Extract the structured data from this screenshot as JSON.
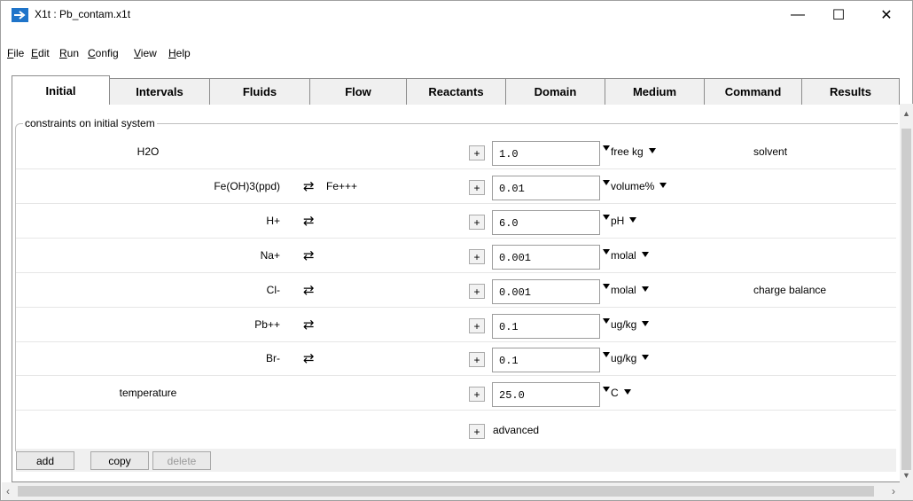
{
  "window": {
    "title": "X1t : Pb_contam.x1t"
  },
  "menu": [
    {
      "pre": "",
      "u": "F",
      "post": "ile"
    },
    {
      "pre": "",
      "u": "E",
      "post": "dit"
    },
    {
      "pre": "",
      "u": "R",
      "post": "un"
    },
    {
      "pre": "",
      "u": "C",
      "post": "onfig"
    },
    {
      "pre": "",
      "u": "V",
      "post": "iew"
    },
    {
      "pre": "",
      "u": "H",
      "post": "elp"
    }
  ],
  "tabs": [
    "Initial",
    "Intervals",
    "Fluids",
    "Flow",
    "Reactants",
    "Domain",
    "Medium",
    "Command",
    "Results"
  ],
  "active_tab": "Initial",
  "group_label": "constraints on initial system",
  "rows": [
    {
      "name": "H2O",
      "swap": false,
      "species": "",
      "value": "1.0",
      "unit": "free kg",
      "note": "solvent"
    },
    {
      "name": "Fe(OH)3(ppd)",
      "swap": true,
      "species": "Fe+++",
      "value": "0.01",
      "unit": "volume%",
      "note": ""
    },
    {
      "name": "H+",
      "swap": true,
      "species": "",
      "value": "6.0",
      "unit": "pH",
      "note": ""
    },
    {
      "name": "Na+",
      "swap": true,
      "species": "",
      "value": "0.001",
      "unit": "molal",
      "note": ""
    },
    {
      "name": "Cl-",
      "swap": true,
      "species": "",
      "value": "0.001",
      "unit": "molal",
      "note": "charge balance"
    },
    {
      "name": "Pb++",
      "swap": true,
      "species": "",
      "value": "0.1",
      "unit": "ug/kg",
      "note": ""
    },
    {
      "name": "Br-",
      "swap": true,
      "species": "",
      "value": "0.1",
      "unit": "ug/kg",
      "note": ""
    },
    {
      "name": "temperature",
      "swap": false,
      "species": "",
      "value": "25.0",
      "unit": "C",
      "note": ""
    }
  ],
  "advanced_label": "advanced",
  "plus_label": "+",
  "swap_glyph": "⇄",
  "buttons": {
    "add": "add",
    "copy": "copy",
    "delete": "delete"
  },
  "window_controls": {
    "minimize": "—",
    "maximize": "☐",
    "close": "✕"
  }
}
